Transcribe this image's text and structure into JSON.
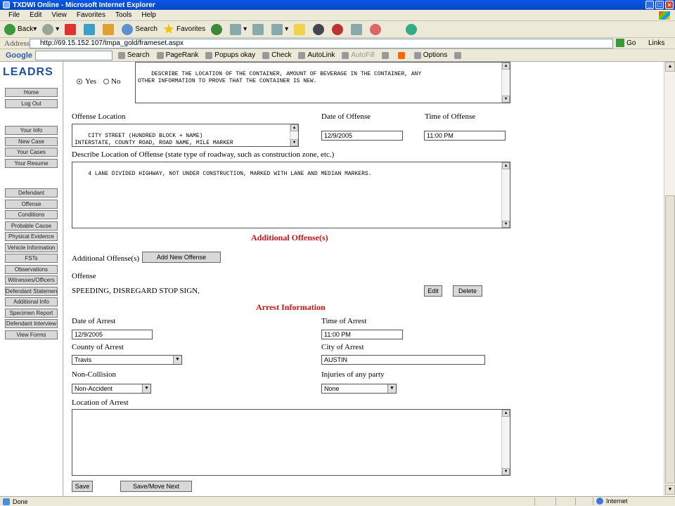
{
  "window": {
    "title": "TXDWI Online - Microsoft Internet Explorer"
  },
  "menu": [
    "File",
    "Edit",
    "View",
    "Favorites",
    "Tools",
    "Help"
  ],
  "toolbar": {
    "back": "Back",
    "search": "Search",
    "favorites": "Favorites"
  },
  "address": {
    "label": "Address",
    "url": "http://69.15.152.107/tmpa_gold/frameset.aspx",
    "go": "Go",
    "links": "Links"
  },
  "google": {
    "logo": "Google",
    "search": "Search",
    "pagerank": "PageRank",
    "popups": "Popups okay",
    "check": "Check",
    "autolink": "AutoLink",
    "autofill": "AutoFill",
    "options": "Options"
  },
  "sidebar": {
    "logo": "LEADRS",
    "items": [
      "Home",
      "Log Out",
      "Your Info",
      "New Case",
      "Your Cases",
      "Your Resume",
      "Defendant",
      "Offense",
      "Conditions",
      "Probable Cause",
      "Physical Evidence",
      "Vehicle Information",
      "FSTs",
      "Observations",
      "Witnesses/Officers",
      "Defendant Statement",
      "Additional Info",
      "Specimen Report",
      "Defendant Interview",
      "View Forms"
    ]
  },
  "form": {
    "container_desc": "DESCRIBE THE LOCATION OF THE CONTAINER, AMOUNT OF BEVERAGE IN THE CONTAINER, ANY\nOTHER INFORMATION TO PROVE THAT THE CONTAINER IS NEW.",
    "yes_label": "Yes",
    "no_label": "No",
    "offense_location_label": "Offense Location",
    "offense_location": "CITY STREET (HUNDRED BLOCK + NAME)\nINTERSTATE, COUNTY ROAD, ROAD NAME, MILE MARKER",
    "date_of_offense_label": "Date of Offense",
    "date_of_offense": "12/9/2005",
    "time_of_offense_label": "Time of Offense",
    "time_of_offense": "11:00 PM",
    "describe_location_label": "Describe Location of Offense (state type of roadway, such as construction zone, etc.)",
    "describe_location": "4 LANE DIVIDED HIGHWAY, NOT UNDER CONSTRUCTION, MARKED WITH LANE AND MEDIAN MARKERS.",
    "additional_offenses_heading": "Additional Offense(s)",
    "additional_offenses_label": "Additional Offense(s)",
    "add_new_offense": "Add New Offense",
    "offense_label": "Offense",
    "offense_value": "SPEEDING, DISREGARD STOP SIGN,",
    "edit": "Edit",
    "delete": "Delete",
    "arrest_heading": "Arrest Information",
    "date_of_arrest_label": "Date of Arrest",
    "date_of_arrest": "12/9/2005",
    "time_of_arrest_label": "Time of Arrest",
    "time_of_arrest": "11:00 PM",
    "county_label": "County of Arrest",
    "county": "Travis",
    "city_label": "City of Arrest",
    "city": "AUSTIN",
    "non_collision_label": "Non-Collision",
    "non_collision": "Non-Accident",
    "injuries_label": "Injuries of any party",
    "injuries": "None",
    "location_of_arrest_label": "Location of Arrest",
    "save": "Save",
    "save_next": "Save/Move Next"
  },
  "status": {
    "left": "Done",
    "zone": "Internet"
  }
}
